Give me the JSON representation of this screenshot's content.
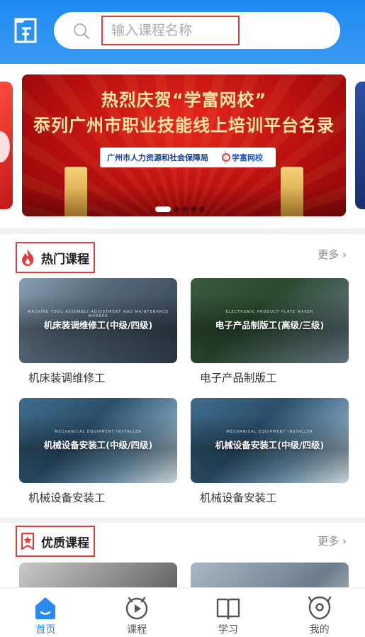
{
  "search": {
    "placeholder": "输入课程名称"
  },
  "banner": {
    "line1": "热烈庆贺“学富网校”",
    "line2": "忝列广州市职业技能线上培训平台名录",
    "org": "广州市人力资源和社会保障局",
    "brand": "学富网校",
    "active_slide": 1,
    "slide_count": 5
  },
  "hot": {
    "title": "热门课程",
    "more": "更多",
    "courses": [
      {
        "caption": "机床装调维修工(中级/四级)",
        "name": "机床装调维修工"
      },
      {
        "caption": "电子产品制版工(高级/三级)",
        "name": "电子产品制版工"
      },
      {
        "caption": "机械设备安装工(中级/四级)",
        "name": "机械设备安装工"
      },
      {
        "caption": "机械设备安装工(中级/四级)",
        "name": "机械设备安装工"
      }
    ]
  },
  "quality": {
    "title": "优质课程",
    "more": "更多"
  },
  "tabs": [
    {
      "label": "首页",
      "icon": "home-icon",
      "active": true
    },
    {
      "label": "课程",
      "icon": "play-icon",
      "active": false
    },
    {
      "label": "学习",
      "icon": "book-icon",
      "active": false
    },
    {
      "label": "我的",
      "icon": "profile-icon",
      "active": false
    }
  ],
  "colors": {
    "primary": "#2a8af0",
    "highlight": "#e53b3b"
  }
}
